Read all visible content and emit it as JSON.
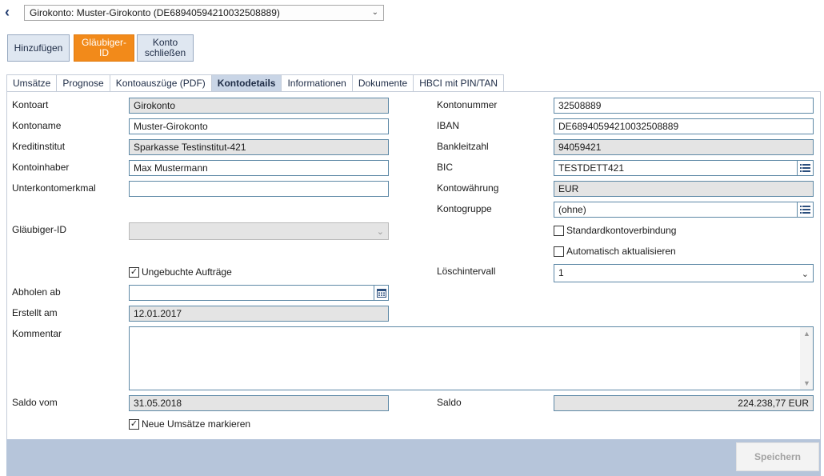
{
  "header": {
    "back_glyph": "‹",
    "account_select": "Girokonto: Muster-Girokonto (DE68940594210032508889)"
  },
  "actions": {
    "add": "Hinzufügen",
    "creditor_id": "Gläubiger-ID",
    "close_account": "Konto schließen"
  },
  "tabs": [
    {
      "label": "Umsätze"
    },
    {
      "label": "Prognose"
    },
    {
      "label": "Kontoauszüge (PDF)"
    },
    {
      "label": "Kontodetails",
      "active": true
    },
    {
      "label": "Informationen"
    },
    {
      "label": "Dokumente"
    },
    {
      "label": "HBCI mit PIN/TAN"
    }
  ],
  "form": {
    "kontoart": {
      "label": "Kontoart",
      "value": "Girokonto"
    },
    "kontoname": {
      "label": "Kontoname",
      "value": "Muster-Girokonto"
    },
    "kreditinstitut": {
      "label": "Kreditinstitut",
      "value": "Sparkasse Testinstitut-421"
    },
    "kontoinhaber": {
      "label": "Kontoinhaber",
      "value": "Max Mustermann"
    },
    "unterkontomerkmal": {
      "label": "Unterkontomerkmal",
      "value": ""
    },
    "glaeubiger_id": {
      "label": "Gläubiger-ID",
      "value": ""
    },
    "ungebuchte": {
      "label": "Ungebuchte Aufträge",
      "checked": true
    },
    "abholen_ab": {
      "label": "Abholen ab",
      "value": ""
    },
    "erstellt_am": {
      "label": "Erstellt am",
      "value": "12.01.2017"
    },
    "kommentar": {
      "label": "Kommentar",
      "value": ""
    },
    "saldo_vom": {
      "label": "Saldo vom",
      "value": "31.05.2018"
    },
    "neue_umsaetze": {
      "label": "Neue Umsätze markieren",
      "checked": true
    },
    "kontonummer": {
      "label": "Kontonummer",
      "value": "32508889"
    },
    "iban": {
      "label": "IBAN",
      "value": "DE68940594210032508889"
    },
    "bankleitzahl": {
      "label": "Bankleitzahl",
      "value": "94059421"
    },
    "bic": {
      "label": "BIC",
      "value": "TESTDETT421"
    },
    "kontowaehrung": {
      "label": "Kontowährung",
      "value": "EUR"
    },
    "kontogruppe": {
      "label": "Kontogruppe",
      "value": "(ohne)"
    },
    "standard": {
      "label": "Standardkontoverbindung",
      "checked": false
    },
    "auto": {
      "label": "Automatisch aktualisieren",
      "checked": false
    },
    "loeschintervall": {
      "label": "Löschintervall",
      "value": "1"
    },
    "saldo": {
      "label": "Saldo",
      "value": "224.238,77 EUR"
    }
  },
  "footer": {
    "save": "Speichern"
  }
}
